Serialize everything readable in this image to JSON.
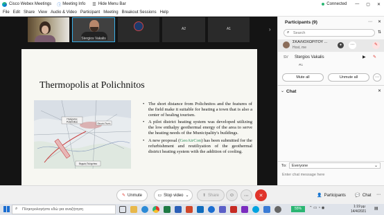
{
  "titlebar": {
    "app_name": "Cisco Webex Meetings",
    "meeting_info": "Meeting Info",
    "hide_menu_bar": "Hide Menu Bar",
    "status": "Connected"
  },
  "menu": [
    "File",
    "Edit",
    "Share",
    "View",
    "Audio & Video",
    "Participant",
    "Meeting",
    "Breakout Sessions",
    "Help"
  ],
  "thumbnails": {
    "presenter_name": "Stergios Vakalis",
    "tile_a2": "A2",
    "tile_a1": "A1"
  },
  "slide": {
    "title": "Thermopolis at Polichnitos",
    "bullet1": "The short distance from Polichnitos and the features of the field make it suitable for heating a town that is also a center of healing tourism.",
    "bullet2": "A pilot district heating system was developed utilizing the low enthalpy geothermal energy of the area to serve the heating needs of the Municipality's buildings.",
    "bullet3_before": "A new proposal (",
    "bullet3_project": "GeoAirCon",
    "bullet3_after": ") has been submitted for the refurbishment and reutiliyation of the geothermal district heating system with the addition of cooling.",
    "map_labels": {
      "town": "Πολίχνιτος",
      "town2": "Polichnitos",
      "spring": "Θερμές Πηγές",
      "bottom": "Θερμές Πολιχνίτου"
    }
  },
  "participants": {
    "header": "Participants (9)",
    "search_placeholder": "Search",
    "host_name": "ΣΚΑΛΙΟΧΩΡΙΤΟΥ ...",
    "host_role": "Host, me",
    "member_name": "Stergios Vakalis",
    "member_initials": "SV",
    "row3": "A1",
    "mute_all": "Mute all",
    "unmute_all": "Unmute all"
  },
  "chat": {
    "header": "Chat",
    "to_label": "To:",
    "to_value": "Everyone",
    "input_placeholder": "Enter chat message here"
  },
  "controls": {
    "unmute": "Unmute",
    "stop_video": "Stop video",
    "share": "Share",
    "participants": "Participants",
    "chat": "Chat"
  },
  "taskbar": {
    "search_placeholder": "Πληκτρολογήστε εδώ για αναζήτηση",
    "battery": "55%",
    "time": "1:19 μμ",
    "date": "14/4/2021"
  },
  "colors": {
    "accent_blue": "#1b6ed1",
    "end_red": "#e0342b",
    "slide_bg": "#f7f7f2",
    "project_green": "#2b8a57"
  }
}
